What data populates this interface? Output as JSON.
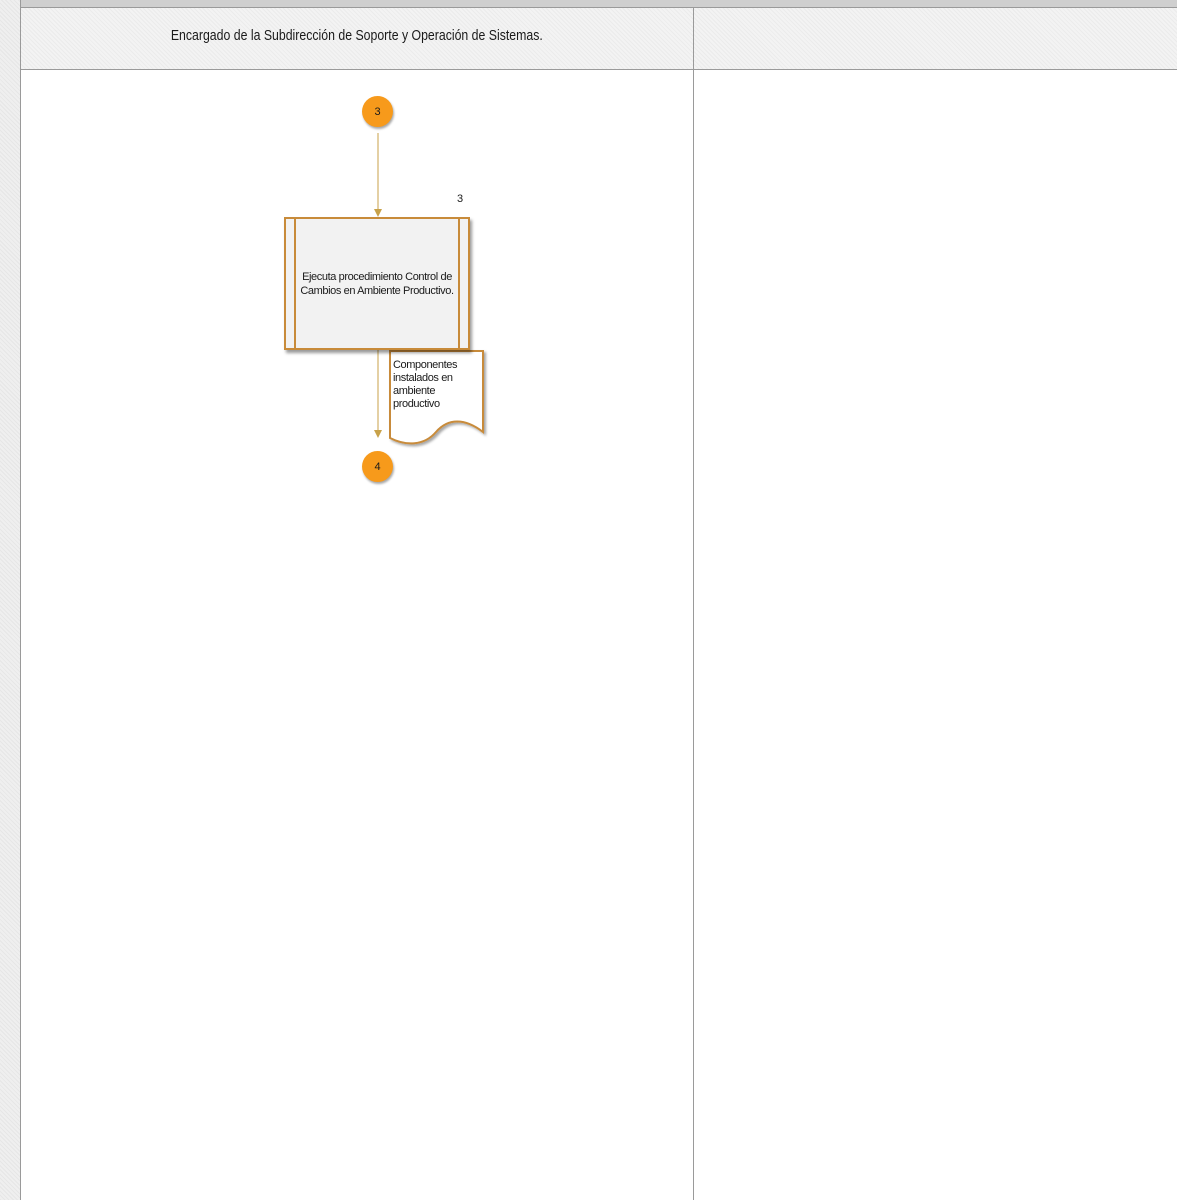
{
  "lanes": [
    {
      "title": "Encargado de la Subdirección de Soporte y Operación de Sistemas."
    },
    {
      "title": ""
    }
  ],
  "connectors": {
    "start": "3",
    "end": "4"
  },
  "process": {
    "step": "3",
    "text": "Ejecuta procedimiento Control de Cambios en Ambiente Productivo."
  },
  "document": {
    "text": "Componentes instalados en ambiente productivo"
  },
  "colors": {
    "connector_fill": "#f79a1b",
    "process_border": "#c88b3a",
    "arrow": "#c8a24a",
    "process_fill": "#f2f2f2"
  }
}
